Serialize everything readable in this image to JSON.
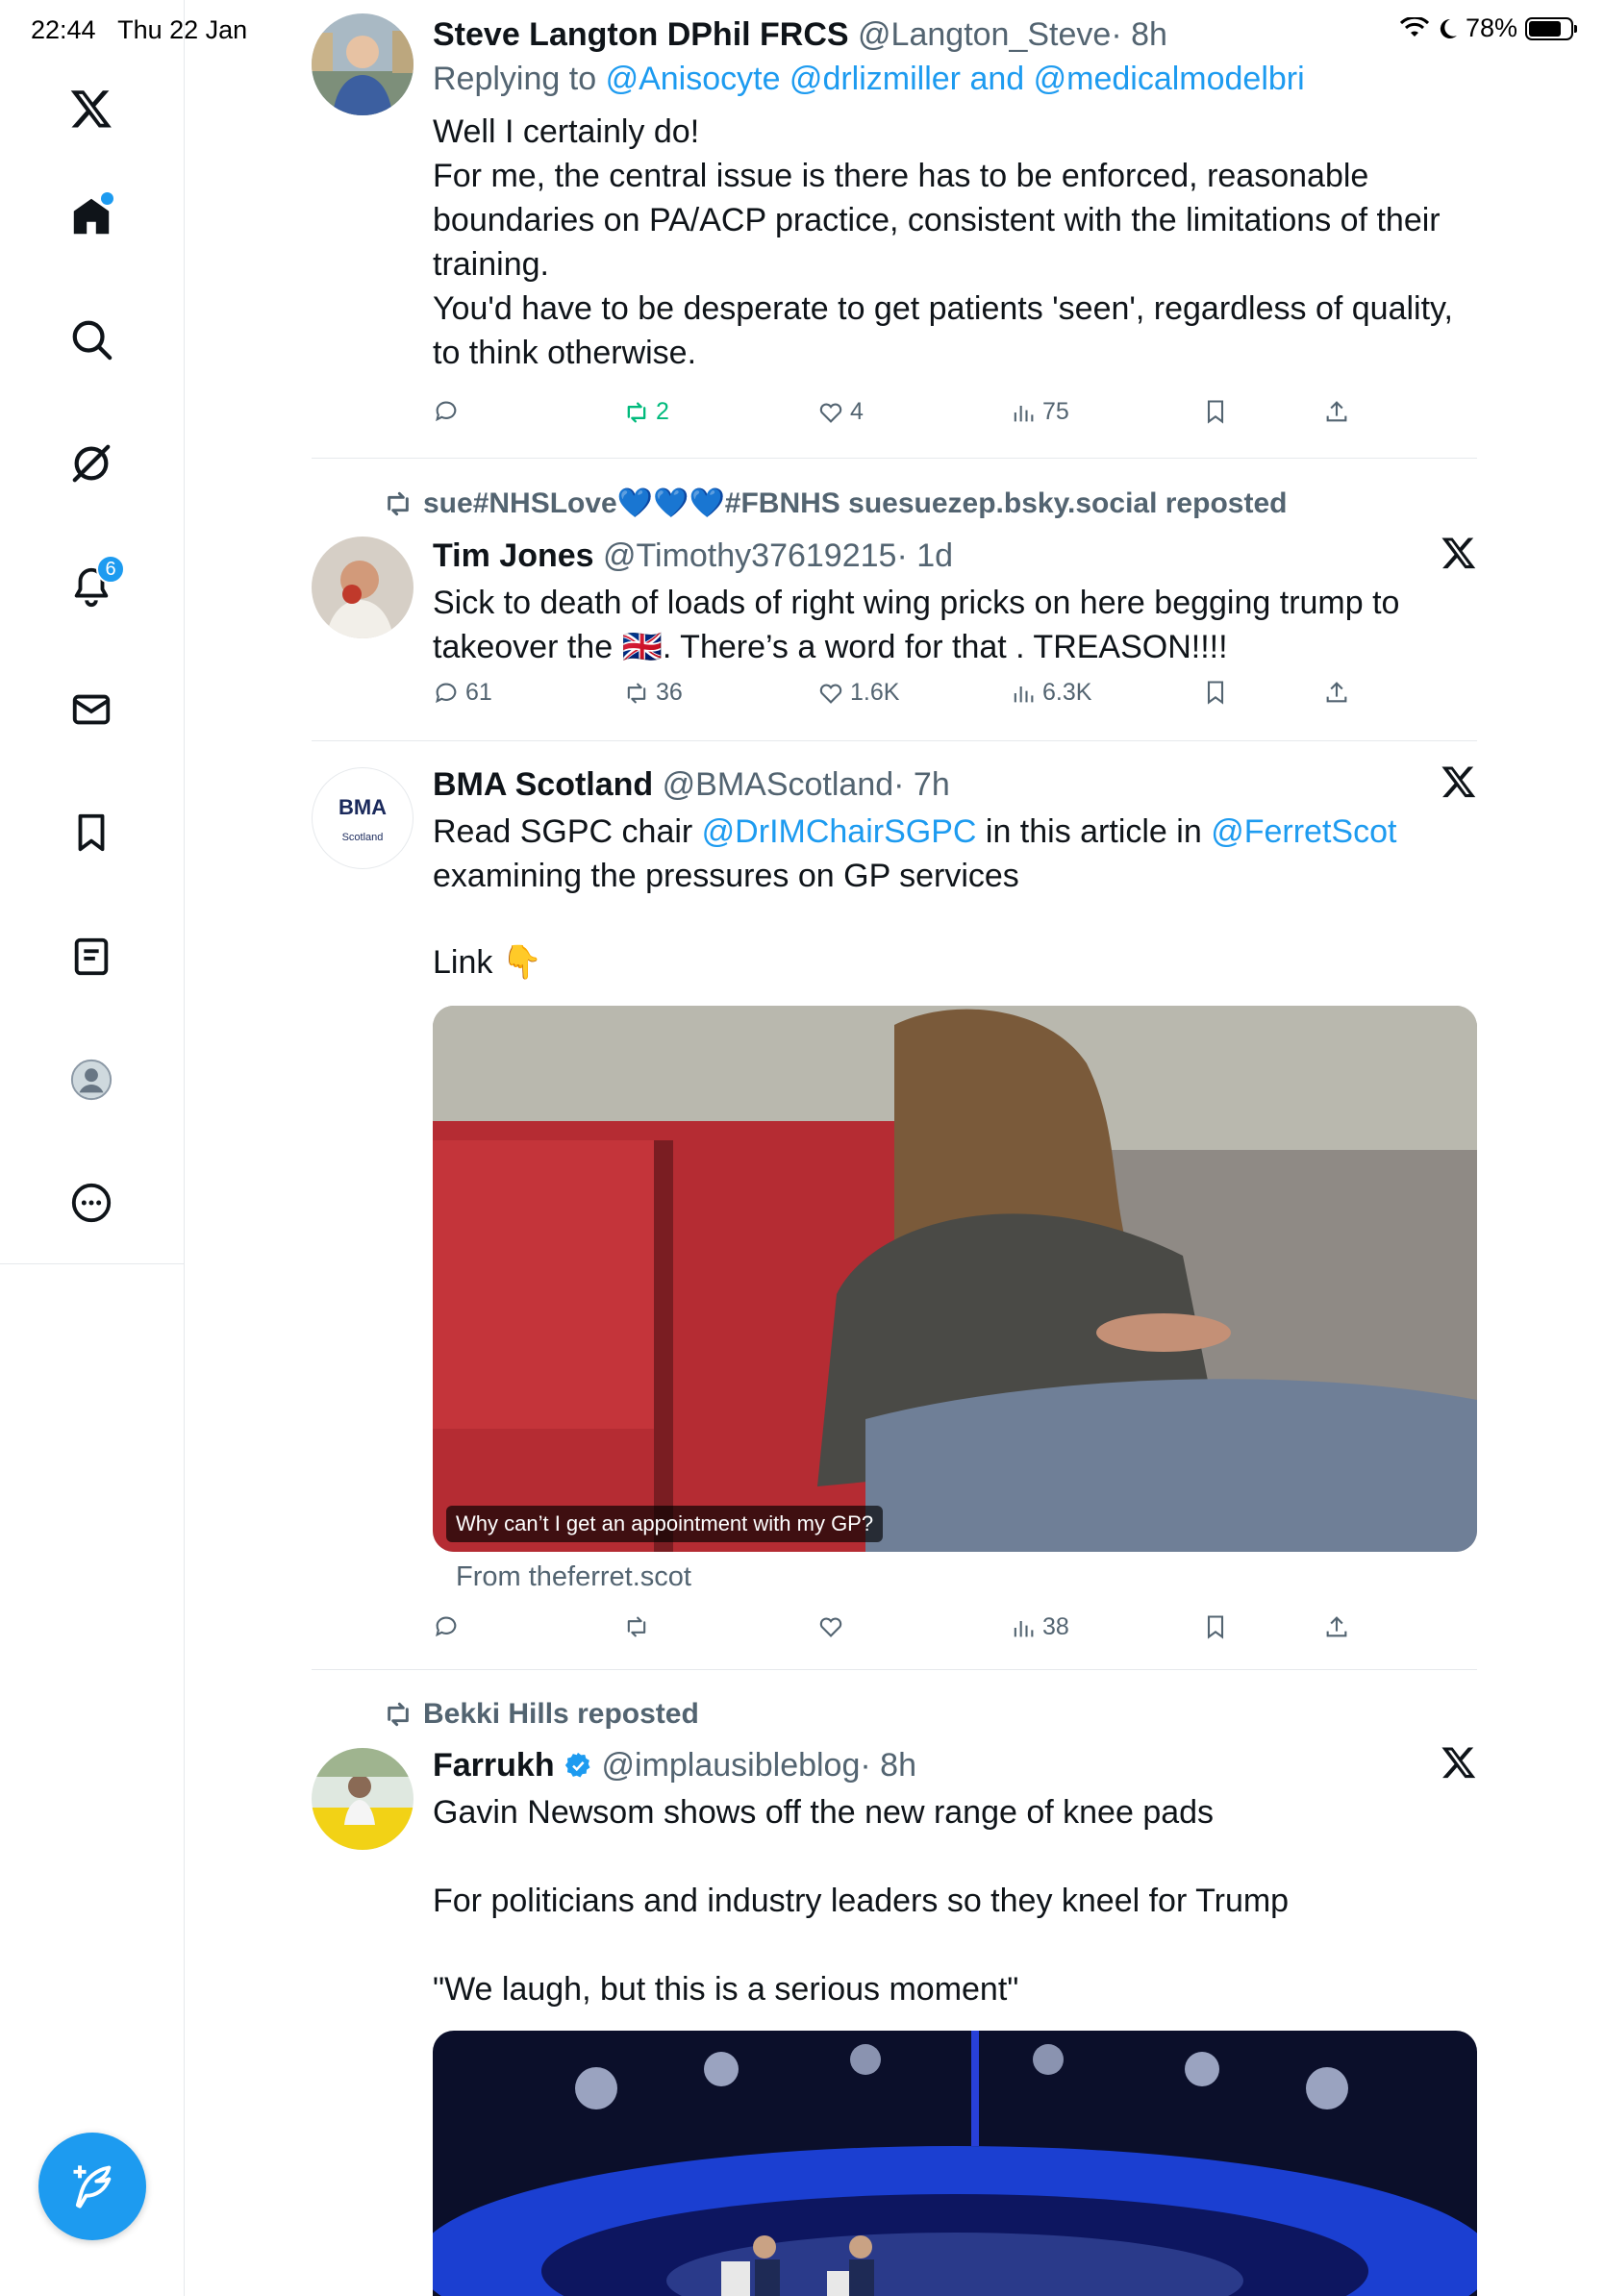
{
  "status_bar": {
    "time": "22:44",
    "date": "Thu 22 Jan",
    "battery": "78%",
    "battery_level": 0.78
  },
  "sidebar": {
    "notifications_badge": "6"
  },
  "colors": {
    "accent": "#1d9bf0",
    "repost_green": "#00ba7c",
    "text_secondary": "#536471"
  },
  "tweets": [
    {
      "name": "Steve Langton DPhil FRCS",
      "handle": "@Langton_Steve",
      "time": "· 8h",
      "reply_prefix": "Replying to",
      "reply_to": "@Anisocyte @drlizmiller and @medicalmodelbri",
      "body": [
        "Well I certainly do!",
        "For me, the central issue is there has to be enforced, reasonable boundaries on PA/ACP practice, consistent with the limitations of their training.",
        "You'd have to be desperate to get patients 'seen', regardless of quality, to think otherwise."
      ],
      "replies": "",
      "reposts": "2",
      "likes": "4",
      "views": "75"
    },
    {
      "repost_by": "sue#NHSLove💙💙💙#FBNHS suesuezep.bsky.social reposted",
      "name": "Tim Jones",
      "handle": "@Timothy37619215",
      "time": "· 1d",
      "body_part1": "Sick to death of loads of right wing pricks on here begging trump to takeover the 🇬🇧. There’s a word for that . TREASON!!!!",
      "replies": "61",
      "reposts": "36",
      "likes": "1.6K",
      "views": "6.3K"
    },
    {
      "name": "BMA Scotland",
      "handle": "@BMAScotland",
      "time": "· 7h",
      "avatar_logo": "BMA",
      "avatar_sub": "Scotland",
      "body_a": "Read SGPC chair ",
      "mention1": "@DrIMChairSGPC",
      "body_b": " in this article in ",
      "mention2": "@FerretScot",
      "body_c": "examining the pressures on GP services",
      "body_d": "Link 👇",
      "media_caption": "Why can’t I get an appointment with my GP?",
      "from_line": "From theferret.scot",
      "replies": "",
      "reposts": "",
      "likes": "",
      "views": "38"
    },
    {
      "repost_by": "Bekki Hills reposted",
      "name": "Farrukh",
      "handle": "@implausibleblog",
      "time": "· 8h",
      "body": [
        "Gavin Newsom shows off the new range of knee pads",
        "",
        "For politicians and industry leaders so they kneel for Trump",
        "",
        "\"We laugh, but this is a serious moment\""
      ]
    }
  ]
}
